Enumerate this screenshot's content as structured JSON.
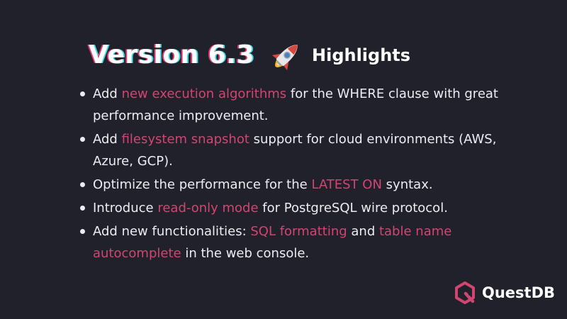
{
  "title": {
    "version": "Version 6.3",
    "rocket_icon": "rocket-icon",
    "highlights": "Highlights"
  },
  "items": [
    {
      "segments": [
        {
          "text": "Add ",
          "highlight": false
        },
        {
          "text": "new execution algorithms",
          "highlight": true
        },
        {
          "text": " for the WHERE clause with great performance improvement.",
          "highlight": false
        }
      ]
    },
    {
      "segments": [
        {
          "text": "Add ",
          "highlight": false
        },
        {
          "text": "filesystem snapshot",
          "highlight": true
        },
        {
          "text": " support for cloud environments (AWS, Azure, GCP).",
          "highlight": false
        }
      ]
    },
    {
      "segments": [
        {
          "text": "Optimize the performance for the ",
          "highlight": false
        },
        {
          "text": "LATEST ON",
          "highlight": true
        },
        {
          "text": " syntax.",
          "highlight": false
        }
      ]
    },
    {
      "segments": [
        {
          "text": "Introduce ",
          "highlight": false
        },
        {
          "text": "read-only mode",
          "highlight": true
        },
        {
          "text": " for PostgreSQL wire protocol.",
          "highlight": false
        }
      ]
    },
    {
      "segments": [
        {
          "text": "Add new functionalities: ",
          "highlight": false
        },
        {
          "text": "SQL formatting",
          "highlight": true
        },
        {
          "text": " and ",
          "highlight": false
        },
        {
          "text": "table name autocomplete",
          "highlight": true
        },
        {
          "text": " in the web console.",
          "highlight": false
        }
      ]
    }
  ],
  "logo": {
    "icon": "questdb-logo-icon",
    "text": "QuestDB"
  },
  "colors": {
    "background": "#21212c",
    "text": "#ececf1",
    "highlight": "#d14671",
    "brand": "#d14671"
  }
}
